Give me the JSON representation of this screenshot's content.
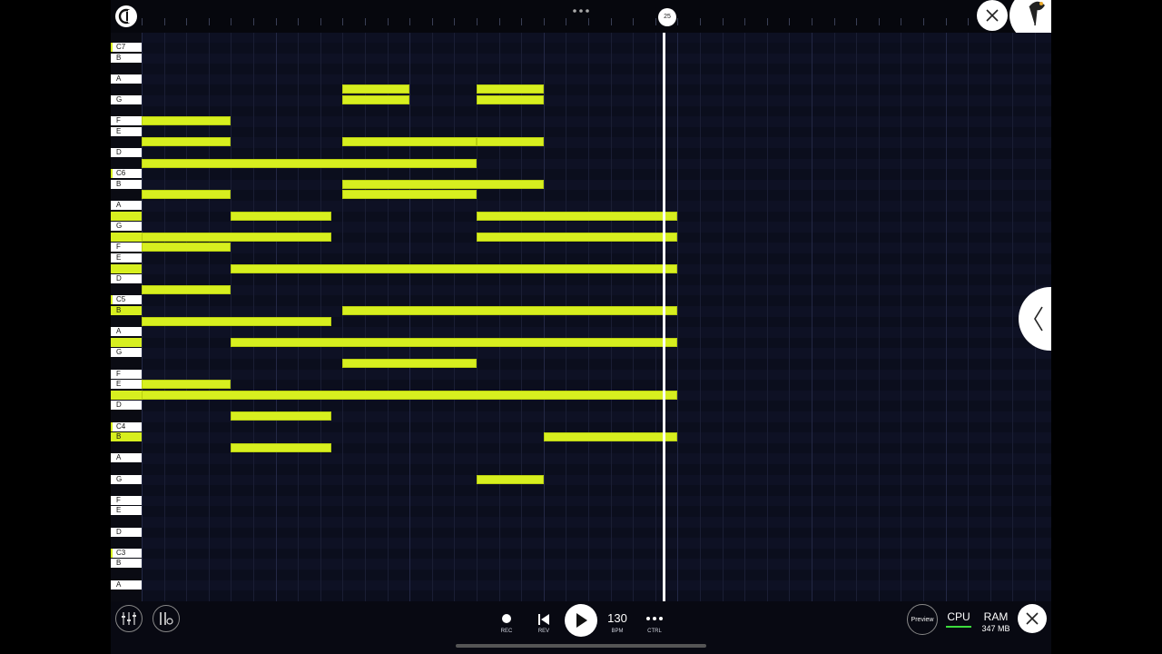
{
  "playhead": {
    "marker_label": "25"
  },
  "piano_keys": [
    {
      "label": "C7",
      "row": 0,
      "c": true
    },
    {
      "label": "B",
      "row": 1
    },
    {
      "label": "A",
      "row": 3
    },
    {
      "label": "G",
      "row": 5
    },
    {
      "label": "F",
      "row": 7
    },
    {
      "label": "E",
      "row": 8
    },
    {
      "label": "D",
      "row": 10
    },
    {
      "label": "C6",
      "row": 12,
      "c": true
    },
    {
      "label": "B",
      "row": 13
    },
    {
      "label": "A",
      "row": 15
    },
    {
      "label": "",
      "row": 16,
      "black": true
    },
    {
      "label": "G",
      "row": 17
    },
    {
      "label": "",
      "row": 18,
      "black": true
    },
    {
      "label": "F",
      "row": 19
    },
    {
      "label": "E",
      "row": 20
    },
    {
      "label": "",
      "row": 21,
      "black": true
    },
    {
      "label": "D",
      "row": 22
    },
    {
      "label": "C5",
      "row": 24,
      "c": true
    },
    {
      "label": "B",
      "row": 25,
      "active": true
    },
    {
      "label": "A",
      "row": 27
    },
    {
      "label": "",
      "row": 28,
      "black": true
    },
    {
      "label": "G",
      "row": 29
    },
    {
      "label": "F",
      "row": 31
    },
    {
      "label": "E",
      "row": 32
    },
    {
      "label": "",
      "row": 33,
      "black": true
    },
    {
      "label": "D",
      "row": 34
    },
    {
      "label": "C4",
      "row": 36,
      "c": true
    },
    {
      "label": "B",
      "row": 37,
      "active": true
    },
    {
      "label": "A",
      "row": 39
    },
    {
      "label": "G",
      "row": 41
    },
    {
      "label": "F",
      "row": 43
    },
    {
      "label": "E",
      "row": 44
    },
    {
      "label": "D",
      "row": 46
    },
    {
      "label": "C3",
      "row": 48,
      "c": true
    },
    {
      "label": "B",
      "row": 49
    },
    {
      "label": "A",
      "row": 51
    }
  ],
  "notes": [
    {
      "row": 5,
      "start": 9,
      "len": 3
    },
    {
      "row": 5,
      "start": 9,
      "len": 3
    },
    {
      "row": 5.0,
      "start": 9,
      "len": 0
    },
    {
      "row": 4,
      "start": 9,
      "len": 3
    },
    {
      "row": 4,
      "start": 15,
      "len": 3
    },
    {
      "row": 5,
      "start": 15,
      "len": 3
    },
    {
      "row": 7,
      "start": 0,
      "len": 4
    },
    {
      "row": 9,
      "start": 0,
      "len": 4
    },
    {
      "row": 9,
      "start": 9,
      "len": 6
    },
    {
      "row": 9,
      "start": 15,
      "len": 3
    },
    {
      "row": 11,
      "start": 0,
      "len": 15
    },
    {
      "row": 13,
      "start": 9,
      "len": 9
    },
    {
      "row": 14,
      "start": 0,
      "len": 4
    },
    {
      "row": 14,
      "start": 9,
      "len": 6
    },
    {
      "row": 16,
      "start": 4,
      "len": 4.5
    },
    {
      "row": 16,
      "start": 15,
      "len": 9
    },
    {
      "row": 18,
      "start": 0,
      "len": 8.5
    },
    {
      "row": 18,
      "start": 15,
      "len": 9
    },
    {
      "row": 19,
      "start": 0,
      "len": 4
    },
    {
      "row": 21,
      "start": 4,
      "len": 20
    },
    {
      "row": 23,
      "start": 0,
      "len": 4
    },
    {
      "row": 25,
      "start": 9,
      "len": 15
    },
    {
      "row": 26,
      "start": 0,
      "len": 8.5
    },
    {
      "row": 28,
      "start": 4,
      "len": 20
    },
    {
      "row": 30,
      "start": 9,
      "len": 6
    },
    {
      "row": 32,
      "start": 0,
      "len": 4
    },
    {
      "row": 33,
      "start": 0,
      "len": 24
    },
    {
      "row": 35,
      "start": 4,
      "len": 4.5
    },
    {
      "row": 37,
      "start": 18,
      "len": 6
    },
    {
      "row": 38,
      "start": 4,
      "len": 4.5
    },
    {
      "row": 41,
      "start": 15,
      "len": 3
    }
  ],
  "transport": {
    "rec_label": "REC",
    "rev_label": "REV",
    "bpm_value": "130",
    "bpm_label": "BPM",
    "ctrl_label": "CTRL"
  },
  "status": {
    "preview_label": "Preview",
    "cpu_label": "CPU",
    "ram_label": "RAM",
    "ram_value": "347 MB"
  },
  "colors": {
    "note": "#d7ef1f",
    "background": "#0d1022",
    "accent_green": "#3ddc3d"
  },
  "icons": [
    "app-logo-icon",
    "close-icon",
    "more-dots-icon",
    "mixer-icon",
    "instrument-settings-icon",
    "record-icon",
    "rewind-icon",
    "play-icon",
    "ctrl-dots-icon",
    "collapse-chevron-icon"
  ]
}
